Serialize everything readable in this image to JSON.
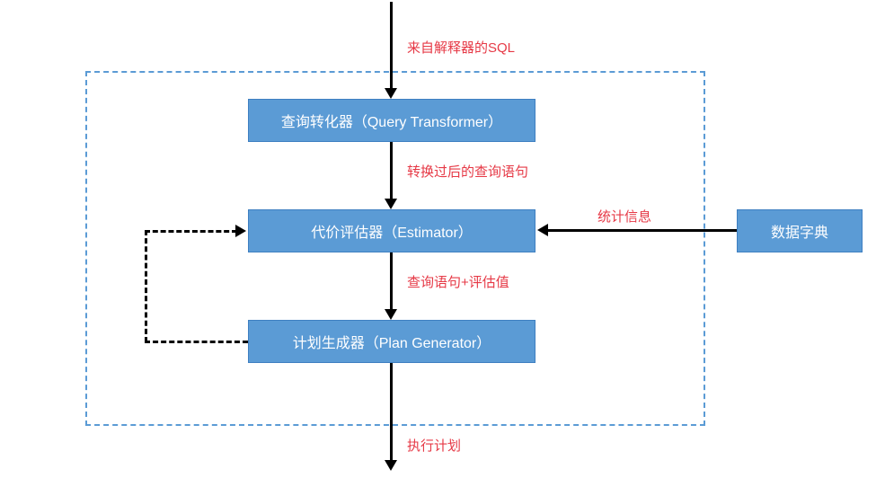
{
  "diagram": {
    "input_label": "来自解释器的SQL",
    "boxes": {
      "query_transformer": "查询转化器（Query Transformer）",
      "estimator": "代价评估器（Estimator）",
      "plan_generator": "计划生成器（Plan Generator）",
      "data_dictionary": "数据字典"
    },
    "edge_labels": {
      "transformed_query": "转换过后的查询语句",
      "stats_info": "统计信息",
      "query_plus_estimate": "查询语句+评估值",
      "execution_plan": "执行计划"
    }
  }
}
